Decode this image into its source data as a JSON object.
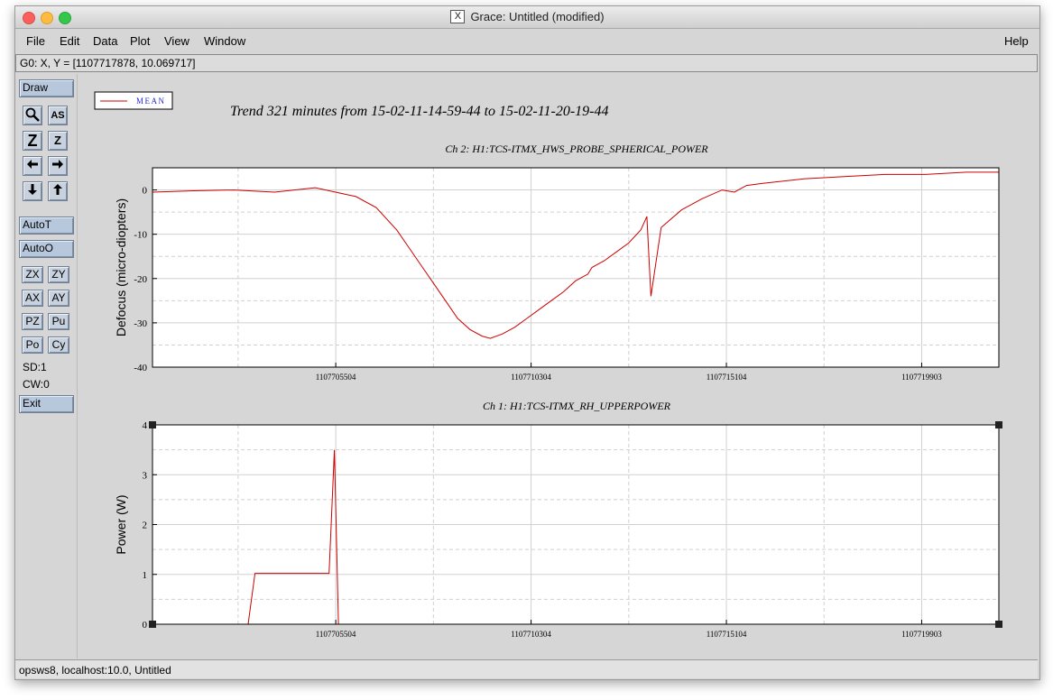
{
  "window": {
    "title": "Grace: Untitled (modified)",
    "x_icon": "X"
  },
  "menu": {
    "file": "File",
    "edit": "Edit",
    "data": "Data",
    "plot": "Plot",
    "view": "View",
    "window": "Window",
    "help": "Help"
  },
  "locator": "G0: X, Y = [1107717878, 10.069717]",
  "toolbar": {
    "draw": "Draw",
    "autot": "AutoT",
    "autoo": "AutoO",
    "zx": "ZX",
    "zy": "ZY",
    "ax": "AX",
    "ay": "AY",
    "pz": "PZ",
    "pu": "Pu",
    "po": "Po",
    "cy": "Cy",
    "sd": "SD:1",
    "cw": "CW:0",
    "exit": "Exit",
    "icons": {
      "zoom": "magnifier-icon",
      "text": "AS",
      "zoom_z_big": "Z",
      "zoom_z_small": "Z",
      "left": "left-arrow-icon",
      "right": "right-arrow-icon",
      "down": "down-arrow-icon",
      "up": "up-arrow-icon"
    }
  },
  "status": "opsws8, localhost:10.0, Untitled",
  "plot": {
    "legend": "MEAN",
    "main_title": "Trend 321 minutes from 15-02-11-14-59-44 to 15-02-11-20-19-44",
    "line_color": "#cc0000"
  },
  "chart_data": [
    {
      "type": "line",
      "title": "Ch 2: H1:TCS-ITMX_HWS_PROBE_SPHERICAL_POWER",
      "ylabel": "Defocus (micro-diopters)",
      "xlabel": "",
      "ylim": [
        -40,
        5
      ],
      "xlim": [
        1107701000,
        1107721800
      ],
      "yticks": [
        0,
        -10,
        -20,
        -30,
        -40
      ],
      "xticks": [
        1107705504,
        1107710304,
        1107715104,
        1107719903
      ],
      "grid": true,
      "series": [
        {
          "name": "MEAN",
          "x": [
            1107701000,
            1107702000,
            1107703000,
            1107704000,
            1107705000,
            1107705500,
            1107706000,
            1107706500,
            1107707000,
            1107707300,
            1107707600,
            1107707900,
            1107708200,
            1107708500,
            1107708800,
            1107709100,
            1107709300,
            1107709600,
            1107709900,
            1107710200,
            1107710500,
            1107710800,
            1107711100,
            1107711400,
            1107711700,
            1107711800,
            1107712100,
            1107712400,
            1107712700,
            1107713000,
            1107713100,
            1107713150,
            1107713250,
            1107713500,
            1107714000,
            1107714500,
            1107715000,
            1107715300,
            1107715600,
            1107716000,
            1107717000,
            1107718000,
            1107719000,
            1107720000,
            1107721000,
            1107721800
          ],
          "y": [
            -0.5,
            -0.2,
            0,
            -0.5,
            0.5,
            -0.5,
            -1.5,
            -4,
            -9,
            -13,
            -17,
            -21,
            -25,
            -29,
            -31.5,
            -33,
            -33.5,
            -32.5,
            -31,
            -29,
            -27,
            -25,
            -23,
            -20.5,
            -19,
            -17.5,
            -16,
            -14,
            -12,
            -9,
            -7,
            -6,
            -24,
            -8.5,
            -4.5,
            -2,
            0,
            -0.5,
            1,
            1.5,
            2.5,
            3,
            3.5,
            3.5,
            4,
            4
          ]
        }
      ]
    },
    {
      "type": "line",
      "title": "Ch 1: H1:TCS-ITMX_RH_UPPERPOWER",
      "ylabel": "Power (W)",
      "xlabel": "",
      "ylim": [
        0,
        4
      ],
      "xlim": [
        1107701000,
        1107721800
      ],
      "yticks": [
        0,
        1,
        2,
        3,
        4
      ],
      "xticks": [
        1107705504,
        1107710304,
        1107715104,
        1107719903
      ],
      "grid": true,
      "series": [
        {
          "name": "MEAN",
          "x": [
            1107701000,
            1107703350,
            1107703520,
            1107705340,
            1107705470,
            1107705570,
            1107721800
          ],
          "y": [
            0,
            0,
            1.02,
            1.02,
            3.5,
            0,
            0
          ]
        }
      ]
    }
  ]
}
